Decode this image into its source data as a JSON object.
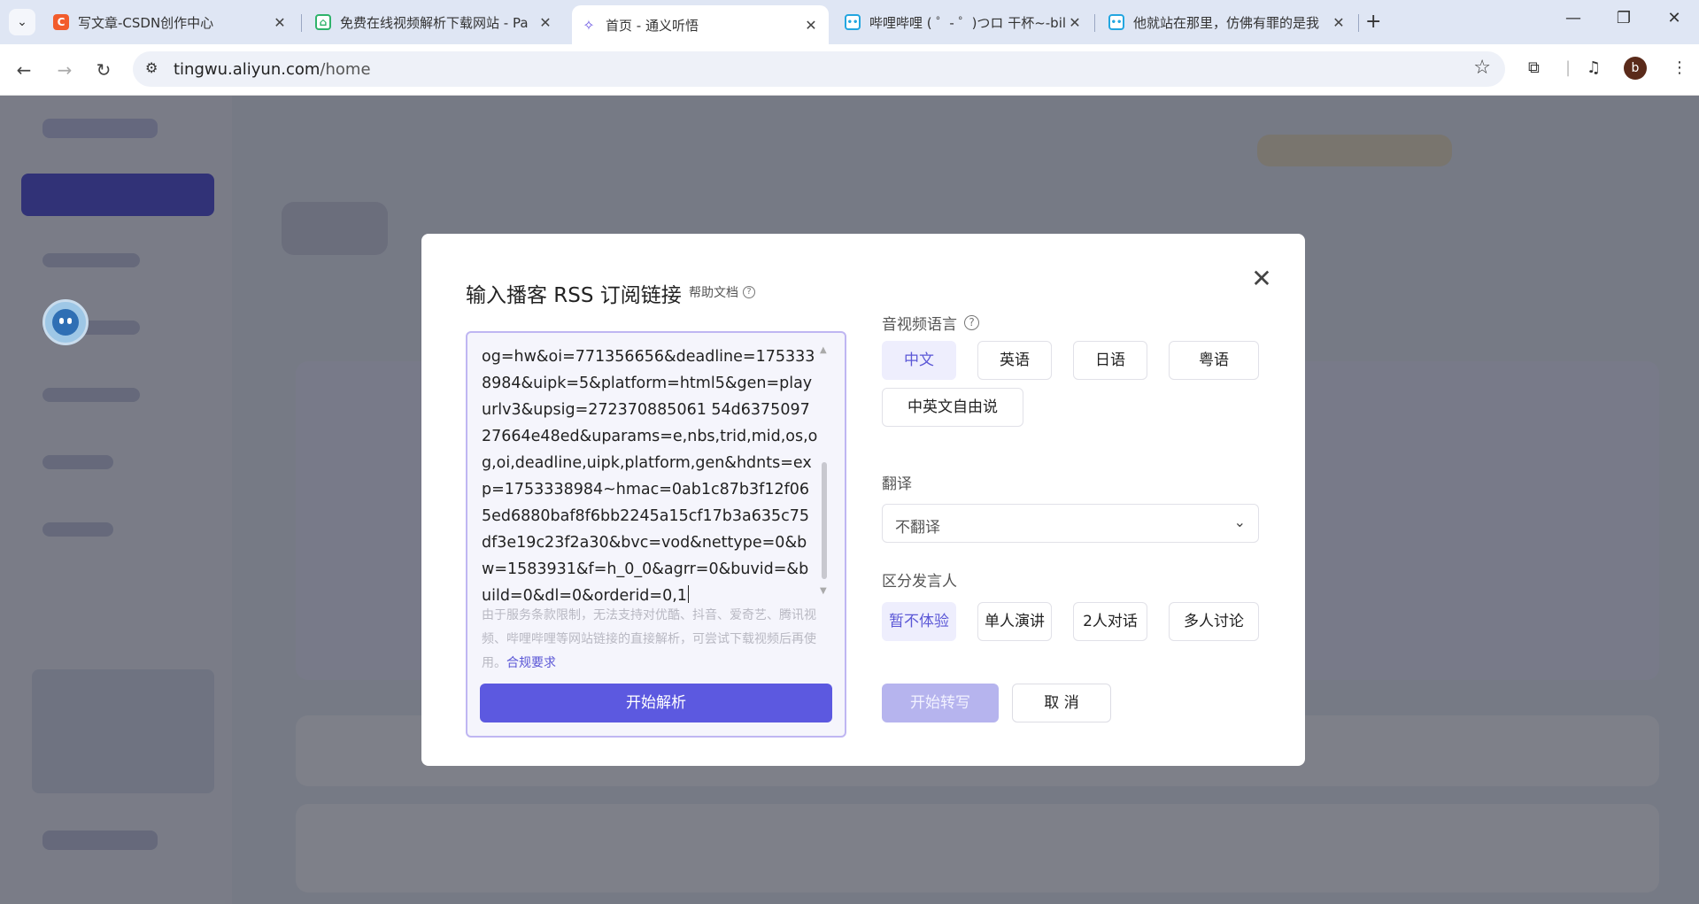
{
  "browser": {
    "tabs": [
      {
        "title": "写文章-CSDN创作中心",
        "favicon": "C",
        "color": "#f25c2c"
      },
      {
        "title": "免费在线视频解析下载网站 - Pa",
        "favicon": "home-icon",
        "color": "#2fb36b"
      },
      {
        "title": "首页 - 通义听悟",
        "favicon": "tingwu-icon",
        "color": "#6b57e3"
      },
      {
        "title": "哔哩哔哩 ( ゜- ゜)つロ 干杯~-bili",
        "favicon": "bilibili-icon",
        "color": "#23a6e0"
      },
      {
        "title": "他就站在那里，仿佛有罪的是我",
        "favicon": "bilibili-icon",
        "color": "#23a6e0"
      }
    ],
    "url_host": "tingwu.aliyun.com",
    "url_path": "/home",
    "profile_initial": "b"
  },
  "modal": {
    "title": "输入播客 RSS 订阅链接",
    "help_doc": "帮助文档",
    "url_value": "og=hw&oi=771356656&deadline=1753338984&uipk=5&platform=html5&gen=playurlv3&upsig=272370885061 54d637509727664e48ed&uparams=e,nbs,trid,mid,os,og,oi,deadline,uipk,platform,gen&hdnts=exp=1753338984~hmac=0ab1c87b3f12f065ed6880baf8f6bb2245a15cf17b3a635c75df3e19c23f2a30&bvc=vod&nettype=0&bw=1583931&f=h_0_0&agrr=0&buvid=&build=0&dl=0&orderid=0,1",
    "notice": "由于服务条款限制，无法支持对优酷、抖音、爱奇艺、腾讯视频、哔哩哔哩等网站链接的直接解析，可尝试下载视频后再使用。",
    "notice_link": "合规要求",
    "parse_button": "开始解析",
    "language_label": "音视频语言",
    "languages": [
      "中文",
      "英语",
      "日语",
      "粤语",
      "中英文自由说"
    ],
    "translate_label": "翻译",
    "translate_value": "不翻译",
    "speaker_label": "区分发言人",
    "speakers": [
      "暂不体验",
      "单人演讲",
      "2人对话",
      "多人讨论"
    ],
    "start_button": "开始转写",
    "cancel_button": "取 消"
  }
}
